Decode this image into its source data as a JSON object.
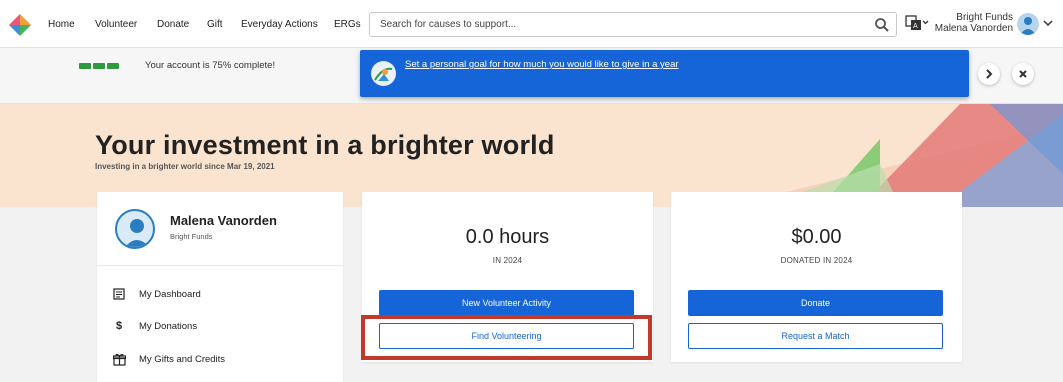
{
  "nav": {
    "items": [
      "Home",
      "Volunteer",
      "Donate",
      "Gift",
      "Everyday Actions",
      "ERGs"
    ]
  },
  "search": {
    "placeholder": "Search for causes to support..."
  },
  "user": {
    "company": "Bright Funds",
    "name": "Malena Vanorden"
  },
  "progress": {
    "text": "Your account is 75% complete!",
    "percent": 75,
    "segments_filled": 3
  },
  "toast": {
    "message": "Set a personal goal for how much you would like to give in a year"
  },
  "hero": {
    "title": "Your investment in a brighter world",
    "since": "Investing in a brighter world since Mar 19, 2021"
  },
  "profile": {
    "name": "Malena Vanorden",
    "org": "Bright Funds",
    "menu": [
      {
        "label": "My Dashboard",
        "icon": "dashboard-icon"
      },
      {
        "label": "My Donations",
        "icon": "dollar-icon"
      },
      {
        "label": "My Gifts and Credits",
        "icon": "gift-icon"
      }
    ]
  },
  "volunteer": {
    "value": "0.0 hours",
    "caption": "IN 2024",
    "primary": "New Volunteer Activity",
    "secondary": "Find Volunteering"
  },
  "donation": {
    "value": "$0.00",
    "caption": "DONATED IN 2024",
    "primary": "Donate",
    "secondary": "Request a Match"
  },
  "colors": {
    "accent": "#1565d8",
    "progress": "#2e9a3e",
    "hero_bg": "#fbe4cf",
    "highlight": "#c0392b"
  }
}
